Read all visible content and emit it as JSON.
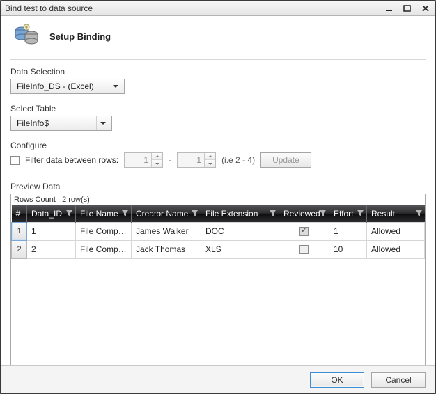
{
  "window": {
    "title": "Bind test to data source"
  },
  "header": {
    "title": "Setup Binding"
  },
  "dataSelection": {
    "label": "Data Selection",
    "value": "FileInfo_DS - (Excel)"
  },
  "selectTable": {
    "label": "Select Table",
    "value": "FileInfo$"
  },
  "configure": {
    "label": "Configure",
    "filterLabel": "Filter data between rows:",
    "filterChecked": false,
    "from": "1",
    "to": "1",
    "dash": "-",
    "hint": "(i.e 2 - 4)",
    "updateLabel": "Update"
  },
  "preview": {
    "label": "Preview Data",
    "rowsCount": "Rows Count : 2 row(s)",
    "columns": {
      "idx": "#",
      "dataId": "Data_ID",
      "fileName": "File Name",
      "creatorName": "Creator Name",
      "fileExtension": "File Extension",
      "reviewed": "Reviewed",
      "effort": "Effort",
      "result": "Result"
    },
    "rows": [
      {
        "idx": "1",
        "dataId": "1",
        "fileName": "File Comparer",
        "creatorName": "James Walker",
        "fileExtension": "DOC",
        "reviewed": true,
        "effort": "1",
        "result": "Allowed"
      },
      {
        "idx": "2",
        "dataId": "2",
        "fileName": "File Comparer",
        "creatorName": "Jack Thomas",
        "fileExtension": "XLS",
        "reviewed": false,
        "effort": "10",
        "result": "Allowed"
      }
    ]
  },
  "footer": {
    "ok": "OK",
    "cancel": "Cancel"
  }
}
